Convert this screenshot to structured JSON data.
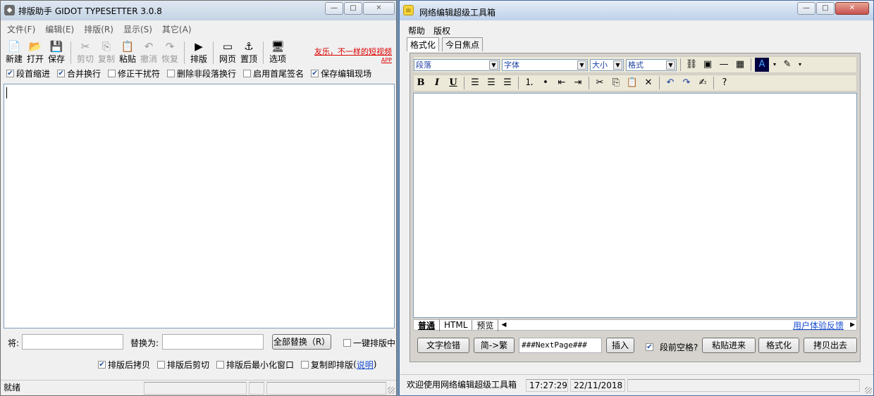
{
  "win1": {
    "title": "排版助手 GIDOT TYPESETTER 3.0.8",
    "menu": [
      "文件(F)",
      "编辑(E)",
      "排版(R)",
      "显示(S)",
      "其它(A)"
    ],
    "toolbar": [
      {
        "label": "新建",
        "icon": "📄",
        "enabled": true
      },
      {
        "label": "打开",
        "icon": "📂",
        "enabled": true
      },
      {
        "label": "保存",
        "icon": "💾",
        "enabled": true
      },
      {
        "sep": true
      },
      {
        "label": "剪切",
        "icon": "✂",
        "enabled": false
      },
      {
        "label": "复制",
        "icon": "⎘",
        "enabled": false
      },
      {
        "label": "粘贴",
        "icon": "📋",
        "enabled": true
      },
      {
        "label": "撤消",
        "icon": "↶",
        "enabled": false
      },
      {
        "label": "恢复",
        "icon": "↷",
        "enabled": false
      },
      {
        "sep": true
      },
      {
        "label": "排版",
        "icon": "▶",
        "enabled": true
      },
      {
        "sep": true
      },
      {
        "label": "网页",
        "icon": "▭",
        "enabled": true
      },
      {
        "label": "置顶",
        "icon": "⚓",
        "enabled": true
      },
      {
        "sep": true
      },
      {
        "label": "选项",
        "icon": "🖥",
        "enabled": true
      }
    ],
    "ad": "友乐，不一样的短视频",
    "ad_app": "APP",
    "options": [
      {
        "label": "段首缩进",
        "checked": true
      },
      {
        "label": "合并换行",
        "checked": true
      },
      {
        "label": "修正干扰符",
        "checked": false
      },
      {
        "label": "删除非段落换行",
        "checked": false
      },
      {
        "label": "启用首尾签名",
        "checked": false
      },
      {
        "label": "保存编辑现场",
        "checked": true
      }
    ],
    "replace_from_label": "将:",
    "replace_to_label": "替换为:",
    "replace_all": "全部替换（R）",
    "one_key": "一键排版中",
    "bottom_options": [
      {
        "label": "排版后拷贝",
        "checked": true
      },
      {
        "label": "排版后剪切",
        "checked": false
      },
      {
        "label": "排版后最小化窗口",
        "checked": false
      },
      {
        "label": "复制即排版",
        "checked": false
      }
    ],
    "help_open": "(",
    "help_link": "说明",
    "help_close": ")",
    "status": "就绪"
  },
  "win2": {
    "title": "网络编辑超级工具箱",
    "menu": [
      "帮助",
      "版权"
    ],
    "tabs": [
      "格式化",
      "今日焦点"
    ],
    "selects": [
      "段落",
      "字体",
      "大小",
      "格式"
    ],
    "format_buttons": [
      "B",
      "I",
      "U"
    ],
    "mode_tabs": [
      "普通",
      "HTML",
      "预览"
    ],
    "feedback": "用户体验反馈",
    "actions": {
      "check": "文字检错",
      "convert": "简->繁",
      "marker": "###NextPage###",
      "insert": "插入",
      "space_label": "段前空格?",
      "space_checked": true,
      "paste_in": "粘贴进来",
      "format": "格式化",
      "copy_out": "拷贝出去"
    },
    "status": {
      "welcome": "欢迎使用网络编辑超级工具箱",
      "time": "17:27:29",
      "date": "22/11/2018"
    }
  }
}
